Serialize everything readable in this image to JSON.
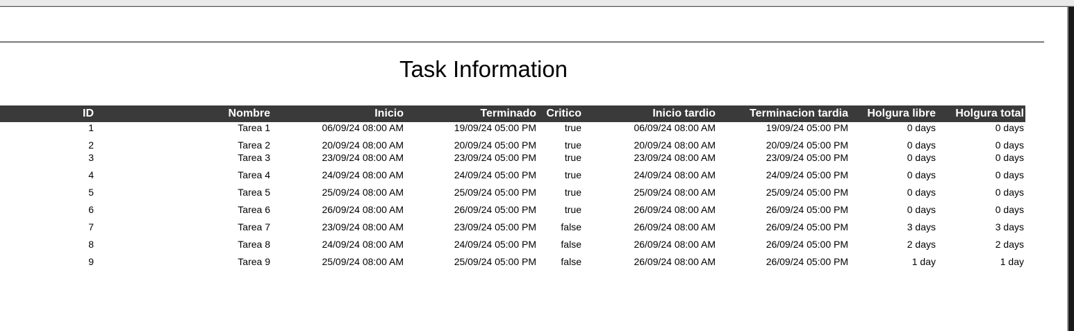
{
  "report": {
    "title": "Task Information",
    "columns": [
      "ID",
      "Nombre",
      "Inicio",
      "Terminado",
      "Critico",
      "Inicio tardio",
      "Terminacion tardia",
      "Holgura libre",
      "Holgura total"
    ],
    "rows": [
      [
        "1",
        "Tarea 1",
        "06/09/24 08:00 AM",
        "19/09/24 05:00 PM",
        "true",
        "06/09/24 08:00 AM",
        "19/09/24 05:00 PM",
        "0 days",
        "0 days"
      ],
      [
        "2",
        "Tarea 2",
        "20/09/24 08:00 AM",
        "20/09/24 05:00 PM",
        "true",
        "20/09/24 08:00 AM",
        "20/09/24 05:00 PM",
        "0 days",
        "0 days"
      ],
      [
        "3",
        "Tarea 3",
        "23/09/24 08:00 AM",
        "23/09/24 05:00 PM",
        "true",
        "23/09/24 08:00 AM",
        "23/09/24 05:00 PM",
        "0 days",
        "0 days"
      ],
      [
        "4",
        "Tarea 4",
        "24/09/24 08:00 AM",
        "24/09/24 05:00 PM",
        "true",
        "24/09/24 08:00 AM",
        "24/09/24 05:00 PM",
        "0 days",
        "0 days"
      ],
      [
        "5",
        "Tarea 5",
        "25/09/24 08:00 AM",
        "25/09/24 05:00 PM",
        "true",
        "25/09/24 08:00 AM",
        "25/09/24 05:00 PM",
        "0 days",
        "0 days"
      ],
      [
        "6",
        "Tarea 6",
        "26/09/24 08:00 AM",
        "26/09/24 05:00 PM",
        "true",
        "26/09/24 08:00 AM",
        "26/09/24 05:00 PM",
        "0 days",
        "0 days"
      ],
      [
        "7",
        "Tarea 7",
        "23/09/24 08:00 AM",
        "23/09/24 05:00 PM",
        "false",
        "26/09/24 08:00 AM",
        "26/09/24 05:00 PM",
        "3 days",
        "3 days"
      ],
      [
        "8",
        "Tarea 8",
        "24/09/24 08:00 AM",
        "24/09/24 05:00 PM",
        "false",
        "26/09/24 08:00 AM",
        "26/09/24 05:00 PM",
        "2 days",
        "2 days"
      ],
      [
        "9",
        "Tarea 9",
        "25/09/24 08:00 AM",
        "25/09/24 05:00 PM",
        "false",
        "26/09/24 08:00 AM",
        "26/09/24 05:00 PM",
        "1 day",
        "1 day"
      ]
    ]
  },
  "colors": {
    "header_background": "#3a3a3a",
    "header_text": "#ffffff",
    "frame_right": "#1a1a1a"
  }
}
